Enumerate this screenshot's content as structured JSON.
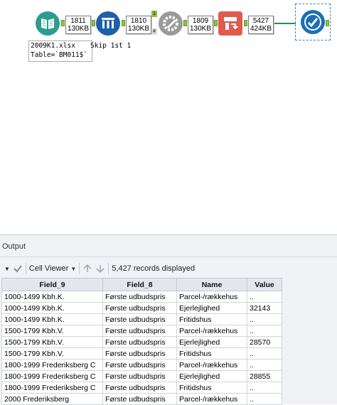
{
  "workflow": {
    "tools": [
      {
        "name": "Input Data",
        "icon": "input-data-book-icon",
        "color": "#2a9d8f"
      },
      {
        "name": "Select Records",
        "icon": "select-records-icon",
        "color": "#1f5fa8"
      },
      {
        "name": "Dynamic Rename",
        "icon": "dynamic-rename-icon",
        "color": "#9a9a9a"
      },
      {
        "name": "Transpose",
        "icon": "transpose-icon",
        "color": "#e05a4e"
      },
      {
        "name": "Browse",
        "icon": "browse-check-icon",
        "color": "#1b6fb5"
      }
    ],
    "connection_stats": [
      {
        "records": "1811",
        "size": "130KB"
      },
      {
        "records": "1810",
        "size": "130KB"
      },
      {
        "records": "1809",
        "size": "130KB"
      },
      {
        "records": "5427",
        "size": "424KB"
      }
    ],
    "annotations": {
      "input_file": "2009K1.xlsx",
      "input_table": "Table=`BM011$`",
      "select_records": "Skip 1st 1"
    },
    "badges": {
      "first": "1",
      "second": "#"
    }
  },
  "output": {
    "panel_title": "Output",
    "toolbar": {
      "viewer_label": "Cell Viewer",
      "records_status": "5,427 records displayed"
    },
    "columns": [
      "Field_9",
      "Field_8",
      "Name",
      "Value"
    ],
    "rows": [
      [
        "1000-1499 Kbh.K.",
        "Første udbudspris",
        "Parcel-/rækkehus",
        ".."
      ],
      [
        "1000-1499 Kbh.K.",
        "Første udbudspris",
        "Ejerlejlighed",
        "32143"
      ],
      [
        "1000-1499 Kbh.K.",
        "Første udbudspris",
        "Fritidshus",
        ".."
      ],
      [
        "1500-1799 Kbh.V.",
        "Første udbudspris",
        "Parcel-/rækkehus",
        ".."
      ],
      [
        "1500-1799 Kbh.V.",
        "Første udbudspris",
        "Ejerlejlighed",
        "28570"
      ],
      [
        "1500-1799 Kbh.V.",
        "Første udbudspris",
        "Fritidshus",
        ".."
      ],
      [
        "1800-1999 Frederiksberg C",
        "Første udbudspris",
        "Parcel-/rækkehus",
        ".."
      ],
      [
        "1800-1999 Frederiksberg C",
        "Første udbudspris",
        "Ejerlejlighed",
        "28855"
      ],
      [
        "1800-1999 Frederiksberg C",
        "Første udbudspris",
        "Fritidshus",
        ".."
      ],
      [
        "2000 Frederiksberg",
        "Første udbudspris",
        "Parcel-/rækkehus",
        ".."
      ]
    ]
  }
}
